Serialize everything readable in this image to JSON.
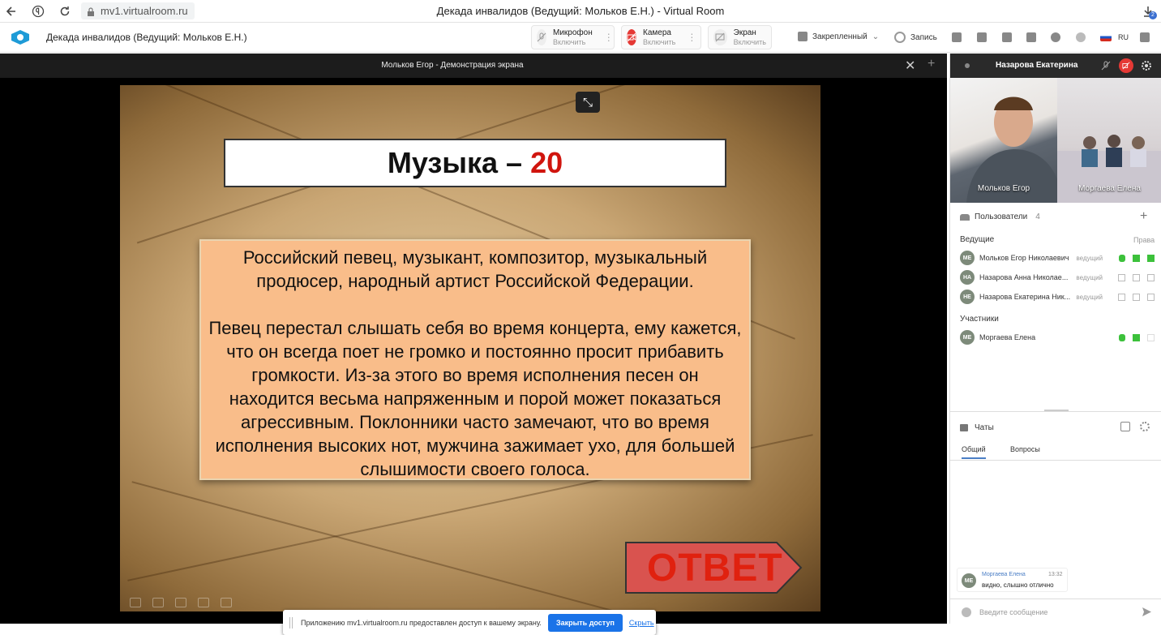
{
  "browser": {
    "url": "mv1.virtualroom.ru",
    "window_title": "Декада инвалидов (Ведущий: Мольков Е.Н.) - Virtual Room",
    "download_badge": "2"
  },
  "header": {
    "room_title": "Декада инвалидов (Ведущий: Мольков Е.Н.)",
    "mic": {
      "title": "Микрофон",
      "sub": "Включить"
    },
    "camera": {
      "title": "Камера",
      "sub": "Включить"
    },
    "screen": {
      "title": "Экран",
      "sub": "Включить"
    },
    "layout": "Закрепленный",
    "record": "Запись",
    "lang": "RU",
    "accent": "#e53935"
  },
  "stage": {
    "title": "Мольков Егор - Демонстрация экрана",
    "slide": {
      "title_text": "Музыка –",
      "title_number": "20",
      "paragraph1": "Российский певец, музыкант, композитор, музыкальный продюсер, народный артист Российской Федерации.",
      "paragraph2": "Певец перестал слышать себя во время концерта, ему кажется, что он всегда поет не громко и постоянно просит прибавить громкости. Из-за этого во время исполнения песен он находится весьма напряженным и порой может показаться агрессивным. Поклонники часто замечают, что во время исполнения высоких нот, мужчина зажимает ухо, для большей слышимости своего голоса.",
      "answer_label": "ОТВЕТ"
    },
    "share_notice": {
      "text": "Приложению mv1.virtualroom.ru предоставлен доступ к вашему экрану.",
      "stop_button": "Закрыть доступ",
      "hide_link": "Скрыть"
    }
  },
  "right_panel": {
    "head_name": "Назарова Екатерина",
    "videos": [
      {
        "label": "Мольков Егор"
      },
      {
        "label": "Моргаева Елена"
      }
    ],
    "users_title": "Пользователи",
    "users_count": "4",
    "hosts_label": "Ведущие",
    "rights_label": "Права",
    "hosts": [
      {
        "initials": "МЕ",
        "name": "Мольков Егор Николаевич",
        "role": "ведущий",
        "active": true
      },
      {
        "initials": "НА",
        "name": "Назарова Анна Николае...",
        "role": "ведущий",
        "active": false
      },
      {
        "initials": "НЕ",
        "name": "Назарова Екатерина Ник...",
        "role": "ведущий",
        "active": false
      }
    ],
    "participants_label": "Участники",
    "participants": [
      {
        "initials": "МЕ",
        "name": "Моргаева Елена",
        "role": "",
        "active": true
      }
    ],
    "chats_title": "Чаты",
    "tabs": [
      "Общий",
      "Вопросы"
    ],
    "message": {
      "initials": "МЕ",
      "author": "Моргаева Елена",
      "time": "13:32",
      "text": "видно, слышно отлично"
    },
    "input_placeholder": "Введите сообщение"
  }
}
